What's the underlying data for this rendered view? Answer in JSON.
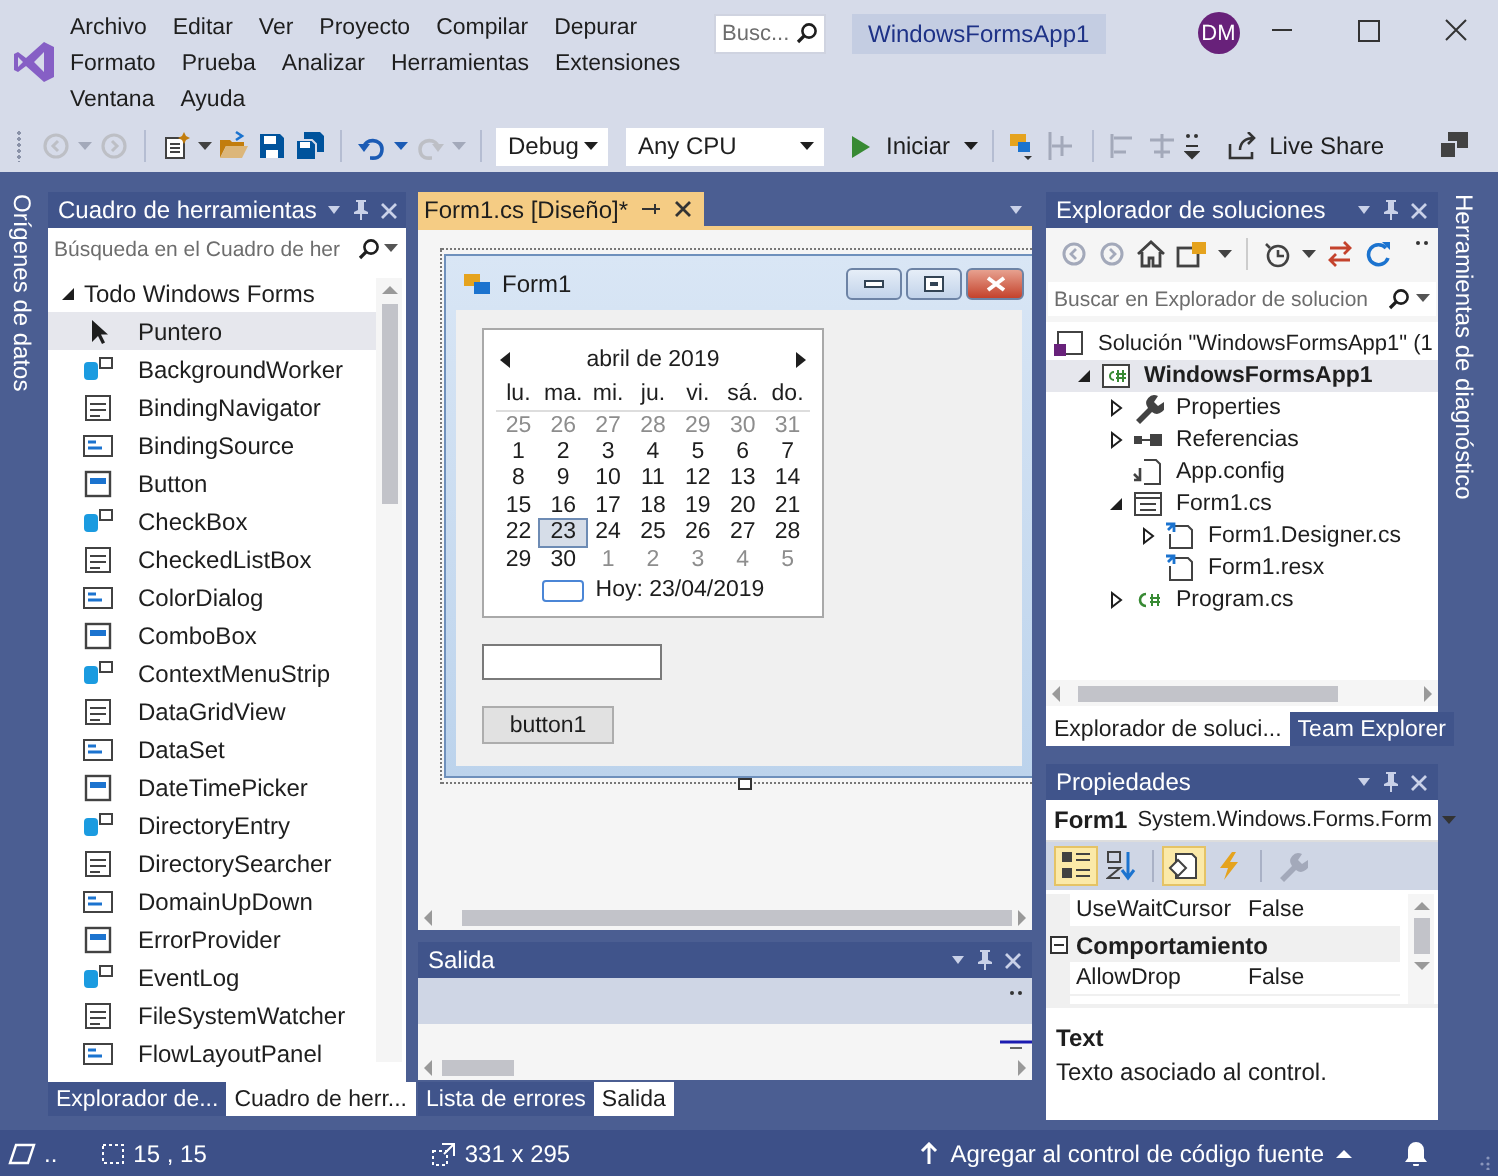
{
  "title_bar": {
    "menu": [
      [
        "Archivo",
        "Editar",
        "Ver",
        "Proyecto",
        "Compilar",
        "Depurar"
      ],
      [
        "Formato",
        "Prueba",
        "Analizar",
        "Herramientas",
        "Extensiones"
      ],
      [
        "Ventana",
        "Ayuda"
      ]
    ],
    "search": {
      "placeholder": "Busc..."
    },
    "title": "WindowsFormsApp1",
    "avatar": "DM"
  },
  "toolbar": {
    "buttons": [
      {
        "kind": "back",
        "disabled": true
      },
      {
        "kind": "forward",
        "disabled": true
      },
      {
        "kind": "new_project",
        "disabled": false
      },
      {
        "kind": "open",
        "disabled": false
      },
      {
        "kind": "save",
        "disabled": false
      },
      {
        "kind": "save_all",
        "disabled": false
      },
      {
        "kind": "undo",
        "disabled": false
      },
      {
        "kind": "redo",
        "disabled": true
      }
    ],
    "configuration": "Debug",
    "platform": "Any CPU",
    "start": "Iniciar",
    "live_share": "Live Share"
  },
  "left_strip": {
    "label": "Orígenes de datos"
  },
  "toolbox": {
    "title": "Cuadro de herramientas",
    "search": {
      "placeholder": "Búsqueda en el Cuadro de her"
    },
    "group": {
      "label": "Todo Windows Forms",
      "expanded": true
    },
    "items": [
      {
        "label": "Puntero",
        "selected": true
      },
      {
        "label": "BackgroundWorker",
        "selected": false
      },
      {
        "label": "BindingNavigator",
        "selected": false
      },
      {
        "label": "BindingSource",
        "selected": false
      },
      {
        "label": "Button",
        "selected": false
      },
      {
        "label": "CheckBox",
        "selected": false
      },
      {
        "label": "CheckedListBox",
        "selected": false
      },
      {
        "label": "ColorDialog",
        "selected": false
      },
      {
        "label": "ComboBox",
        "selected": false
      },
      {
        "label": "ContextMenuStrip",
        "selected": false
      },
      {
        "label": "DataGridView",
        "selected": false
      },
      {
        "label": "DataSet",
        "selected": false
      },
      {
        "label": "DateTimePicker",
        "selected": false
      },
      {
        "label": "DirectoryEntry",
        "selected": false
      },
      {
        "label": "DirectorySearcher",
        "selected": false
      },
      {
        "label": "DomainUpDown",
        "selected": false
      },
      {
        "label": "ErrorProvider",
        "selected": false
      },
      {
        "label": "EventLog",
        "selected": false
      },
      {
        "label": "FileSystemWatcher",
        "selected": false
      },
      {
        "label": "FlowLayoutPanel",
        "selected": false
      }
    ],
    "tabs": [
      {
        "label": "Explorador de...",
        "selected": false
      },
      {
        "label": "Cuadro de herr...",
        "selected": true
      }
    ]
  },
  "designer": {
    "tab": "Form1.cs [Diseño]*",
    "form": {
      "title": "Form1",
      "calendar": {
        "month": "abril de 2019",
        "weekdays": [
          "lu.",
          "ma.",
          "mi.",
          "ju.",
          "vi.",
          "sá.",
          "do."
        ],
        "days": [
          {
            "day": "25",
            "other_month": true,
            "selected": false
          },
          {
            "day": "26",
            "other_month": true,
            "selected": false
          },
          {
            "day": "27",
            "other_month": true,
            "selected": false
          },
          {
            "day": "28",
            "other_month": true,
            "selected": false
          },
          {
            "day": "29",
            "other_month": true,
            "selected": false
          },
          {
            "day": "30",
            "other_month": true,
            "selected": false
          },
          {
            "day": "31",
            "other_month": true,
            "selected": false
          },
          {
            "day": "1",
            "other_month": false,
            "selected": false
          },
          {
            "day": "2",
            "other_month": false,
            "selected": false
          },
          {
            "day": "3",
            "other_month": false,
            "selected": false
          },
          {
            "day": "4",
            "other_month": false,
            "selected": false
          },
          {
            "day": "5",
            "other_month": false,
            "selected": false
          },
          {
            "day": "6",
            "other_month": false,
            "selected": false
          },
          {
            "day": "7",
            "other_month": false,
            "selected": false
          },
          {
            "day": "8",
            "other_month": false,
            "selected": false
          },
          {
            "day": "9",
            "other_month": false,
            "selected": false
          },
          {
            "day": "10",
            "other_month": false,
            "selected": false
          },
          {
            "day": "11",
            "other_month": false,
            "selected": false
          },
          {
            "day": "12",
            "other_month": false,
            "selected": false
          },
          {
            "day": "13",
            "other_month": false,
            "selected": false
          },
          {
            "day": "14",
            "other_month": false,
            "selected": false
          },
          {
            "day": "15",
            "other_month": false,
            "selected": false
          },
          {
            "day": "16",
            "other_month": false,
            "selected": false
          },
          {
            "day": "17",
            "other_month": false,
            "selected": false
          },
          {
            "day": "18",
            "other_month": false,
            "selected": false
          },
          {
            "day": "19",
            "other_month": false,
            "selected": false
          },
          {
            "day": "20",
            "other_month": false,
            "selected": false
          },
          {
            "day": "21",
            "other_month": false,
            "selected": false
          },
          {
            "day": "22",
            "other_month": false,
            "selected": false
          },
          {
            "day": "23",
            "other_month": false,
            "selected": true
          },
          {
            "day": "24",
            "other_month": false,
            "selected": false
          },
          {
            "day": "25",
            "other_month": false,
            "selected": false
          },
          {
            "day": "26",
            "other_month": false,
            "selected": false
          },
          {
            "day": "27",
            "other_month": false,
            "selected": false
          },
          {
            "day": "28",
            "other_month": false,
            "selected": false
          },
          {
            "day": "29",
            "other_month": false,
            "selected": false
          },
          {
            "day": "30",
            "other_month": false,
            "selected": false
          },
          {
            "day": "1",
            "other_month": true,
            "selected": false
          },
          {
            "day": "2",
            "other_month": true,
            "selected": false
          },
          {
            "day": "3",
            "other_month": true,
            "selected": false
          },
          {
            "day": "4",
            "other_month": true,
            "selected": false
          },
          {
            "day": "5",
            "other_month": true,
            "selected": false
          }
        ],
        "today": "Hoy: 23/04/2019"
      },
      "button": "button1"
    }
  },
  "output": {
    "title": "Salida",
    "tabs": [
      {
        "label": "Lista de errores",
        "selected": false
      },
      {
        "label": "Salida",
        "selected": true
      }
    ]
  },
  "solution_explorer": {
    "title": "Explorador de soluciones",
    "search": {
      "placeholder": "Buscar en Explorador de solucion"
    },
    "tree": [
      {
        "label": "Solución \"WindowsFormsApp1\" (1",
        "kind": "solution",
        "expanded": true,
        "selected": false,
        "children": [
          {
            "label": "WindowsFormsApp1",
            "kind": "project",
            "expanded": true,
            "selected": true,
            "children": [
              {
                "label": "Properties",
                "kind": "properties",
                "expanded": false,
                "selected": false
              },
              {
                "label": "Referencias",
                "kind": "references",
                "expanded": false,
                "selected": false
              },
              {
                "label": "App.config",
                "kind": "config",
                "selected": false
              },
              {
                "label": "Form1.cs",
                "kind": "form",
                "expanded": true,
                "selected": false,
                "children": [
                  {
                    "label": "Form1.Designer.cs",
                    "kind": "code_page",
                    "expanded": false,
                    "selected": false
                  },
                  {
                    "label": "Form1.resx",
                    "kind": "code_page",
                    "selected": false
                  }
                ]
              },
              {
                "label": "Program.cs",
                "kind": "csharp",
                "expanded": false,
                "selected": false
              }
            ]
          }
        ]
      }
    ],
    "tabs": [
      {
        "label": "Explorador de soluci...",
        "selected": true
      },
      {
        "label": "Team Explorer",
        "selected": false
      }
    ]
  },
  "properties": {
    "title": "Propiedades",
    "object": {
      "name": "Form1",
      "type": "System.Windows.Forms.Form"
    },
    "buttons": [
      {
        "kind": "categorized",
        "selected": true
      },
      {
        "kind": "alphabetical",
        "selected": false
      },
      {
        "kind": "properties",
        "selected": true
      },
      {
        "kind": "events",
        "selected": false
      },
      {
        "kind": "pages",
        "selected": false
      }
    ],
    "rows": [
      {
        "kind": "property",
        "name": "UseWaitCursor",
        "value": "False"
      },
      {
        "kind": "category",
        "name": "Comportamiento",
        "expanded": true
      },
      {
        "kind": "property",
        "name": "AllowDrop",
        "value": "False"
      }
    ],
    "description": {
      "title": "Text",
      "text": "Texto asociado al control."
    }
  },
  "right_strip": {
    "label": "Herramientas de diagnóstico"
  },
  "status_bar": {
    "more": "..",
    "position": "15 , 15",
    "size": "331 x 295",
    "source_control": "Agregar al control de código fuente"
  }
}
